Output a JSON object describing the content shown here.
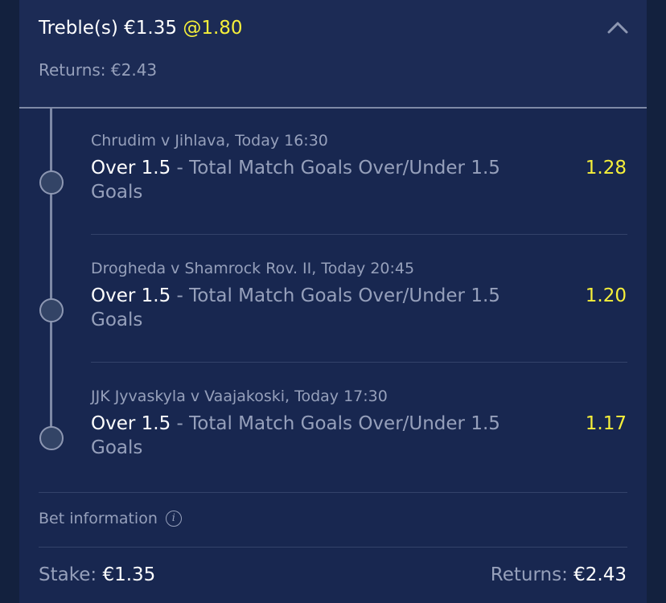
{
  "header": {
    "bet_type": "Treble(s)",
    "stake": "€1.35",
    "odds": "@1.80",
    "returns_label": "Returns:",
    "returns_value": "€2.43",
    "collapse_icon": "chevron-up-icon"
  },
  "legs": [
    {
      "event": "Chrudim v Jihlava, Today 16:30",
      "selection": "Over 1.5",
      "market": " - Total Match Goals Over/Under 1.5 Goals",
      "price": "1.28"
    },
    {
      "event": "Drogheda v Shamrock Rov. II, Today 20:45",
      "selection": "Over 1.5",
      "market": " - Total Match Goals Over/Under 1.5 Goals",
      "price": "1.20"
    },
    {
      "event": "JJK Jyvaskyla v Vaajakoski, Today 17:30",
      "selection": "Over 1.5",
      "market": " - Total Match Goals Over/Under 1.5 Goals",
      "price": "1.17"
    }
  ],
  "bet_info": {
    "label": "Bet information",
    "icon": "info-icon"
  },
  "footer": {
    "stake_label": "Stake:",
    "stake_value": "€1.35",
    "returns_label": "Returns:",
    "returns_value": "€2.43"
  },
  "colors": {
    "background": "#182750",
    "header_bg": "#1c2b55",
    "odds_yellow": "#f5ef3a",
    "muted_text": "#96a0bb",
    "primary_text": "#ffffff"
  }
}
